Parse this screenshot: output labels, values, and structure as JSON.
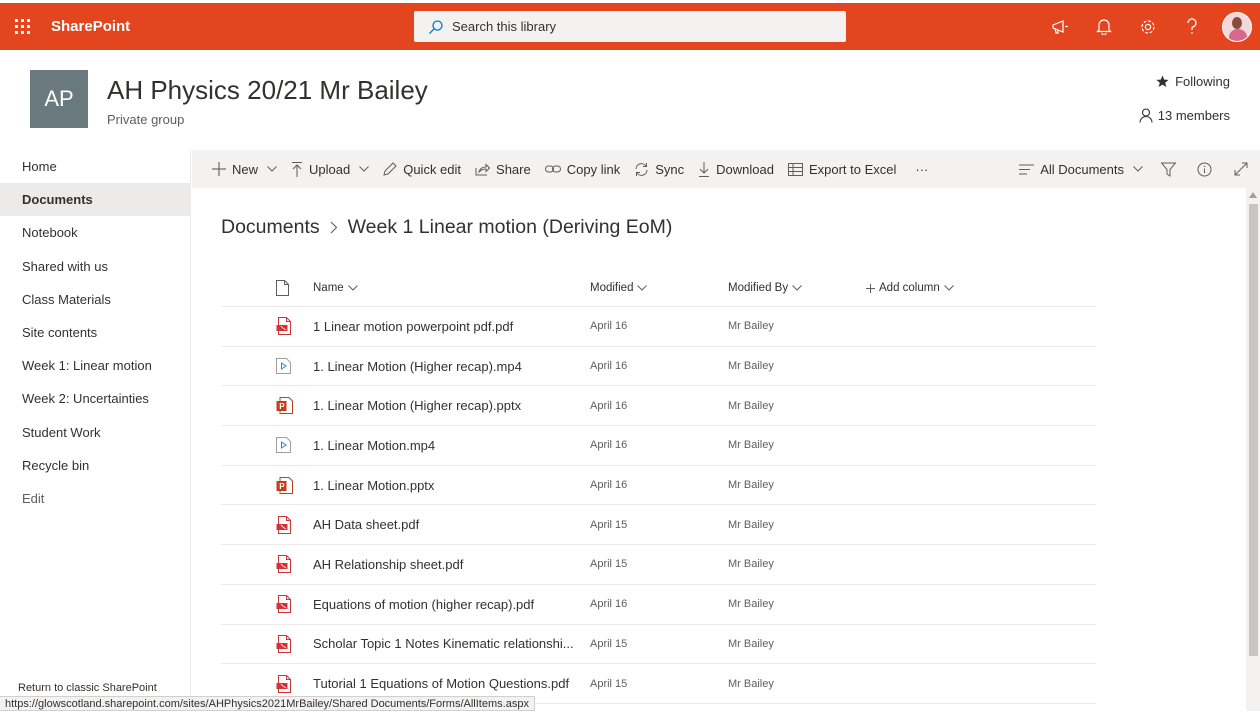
{
  "suite": {
    "brand": "SharePoint",
    "search_placeholder": "Search this library",
    "accent": "#e3461f"
  },
  "site": {
    "logo_initials": "AP",
    "title": "AH Physics 20/21 Mr Bailey",
    "subtitle": "Private group",
    "following_label": "Following",
    "members_label": "13 members",
    "logo_color": "#69797e"
  },
  "nav": {
    "items": [
      {
        "label": "Home"
      },
      {
        "label": "Documents"
      },
      {
        "label": "Notebook"
      },
      {
        "label": "Shared with us"
      },
      {
        "label": "Class Materials"
      },
      {
        "label": "Site contents"
      },
      {
        "label": "Week 1: Linear motion"
      },
      {
        "label": "Week 2: Uncertainties"
      },
      {
        "label": "Student Work"
      },
      {
        "label": "Recycle bin"
      }
    ],
    "edit_label": "Edit",
    "classic_label": "Return to classic SharePoint"
  },
  "commands": {
    "new": "New",
    "upload": "Upload",
    "quick_edit": "Quick edit",
    "share": "Share",
    "copy_link": "Copy link",
    "sync": "Sync",
    "download": "Download",
    "export": "Export to Excel",
    "more": "···",
    "view": "All Documents"
  },
  "breadcrumb": {
    "root": "Documents",
    "current": "Week 1 Linear motion (Deriving EoM)"
  },
  "columns": {
    "name": "Name",
    "modified": "Modified",
    "modified_by": "Modified By",
    "add_column": "Add column"
  },
  "files": [
    {
      "icon": "pdf-icon",
      "name": "1 Linear motion powerpoint pdf.pdf",
      "modified": "April 16",
      "by": "Mr Bailey"
    },
    {
      "icon": "video-icon",
      "name": "1. Linear Motion (Higher recap).mp4",
      "modified": "April 16",
      "by": "Mr Bailey"
    },
    {
      "icon": "powerpoint-icon",
      "name": "1. Linear Motion (Higher recap).pptx",
      "modified": "April 16",
      "by": "Mr Bailey"
    },
    {
      "icon": "video-icon",
      "name": "1. Linear Motion.mp4",
      "modified": "April 16",
      "by": "Mr Bailey"
    },
    {
      "icon": "powerpoint-icon",
      "name": "1. Linear Motion.pptx",
      "modified": "April 16",
      "by": "Mr Bailey"
    },
    {
      "icon": "pdf-icon",
      "name": "AH Data sheet.pdf",
      "modified": "April 15",
      "by": "Mr Bailey"
    },
    {
      "icon": "pdf-icon",
      "name": "AH Relationship sheet.pdf",
      "modified": "April 15",
      "by": "Mr Bailey"
    },
    {
      "icon": "pdf-icon",
      "name": "Equations of motion (higher recap).pdf",
      "modified": "April 16",
      "by": "Mr Bailey"
    },
    {
      "icon": "pdf-icon",
      "name": "Scholar Topic 1 Notes Kinematic relationshi...",
      "modified": "April 15",
      "by": "Mr Bailey"
    },
    {
      "icon": "pdf-icon",
      "name": "Tutorial 1 Equations of Motion Questions.pdf",
      "modified": "April 15",
      "by": "Mr Bailey"
    }
  ],
  "status_url": "https://glowscotland.sharepoint.com/sites/AHPhysics2021MrBailey/Shared Documents/Forms/AllItems.aspx"
}
